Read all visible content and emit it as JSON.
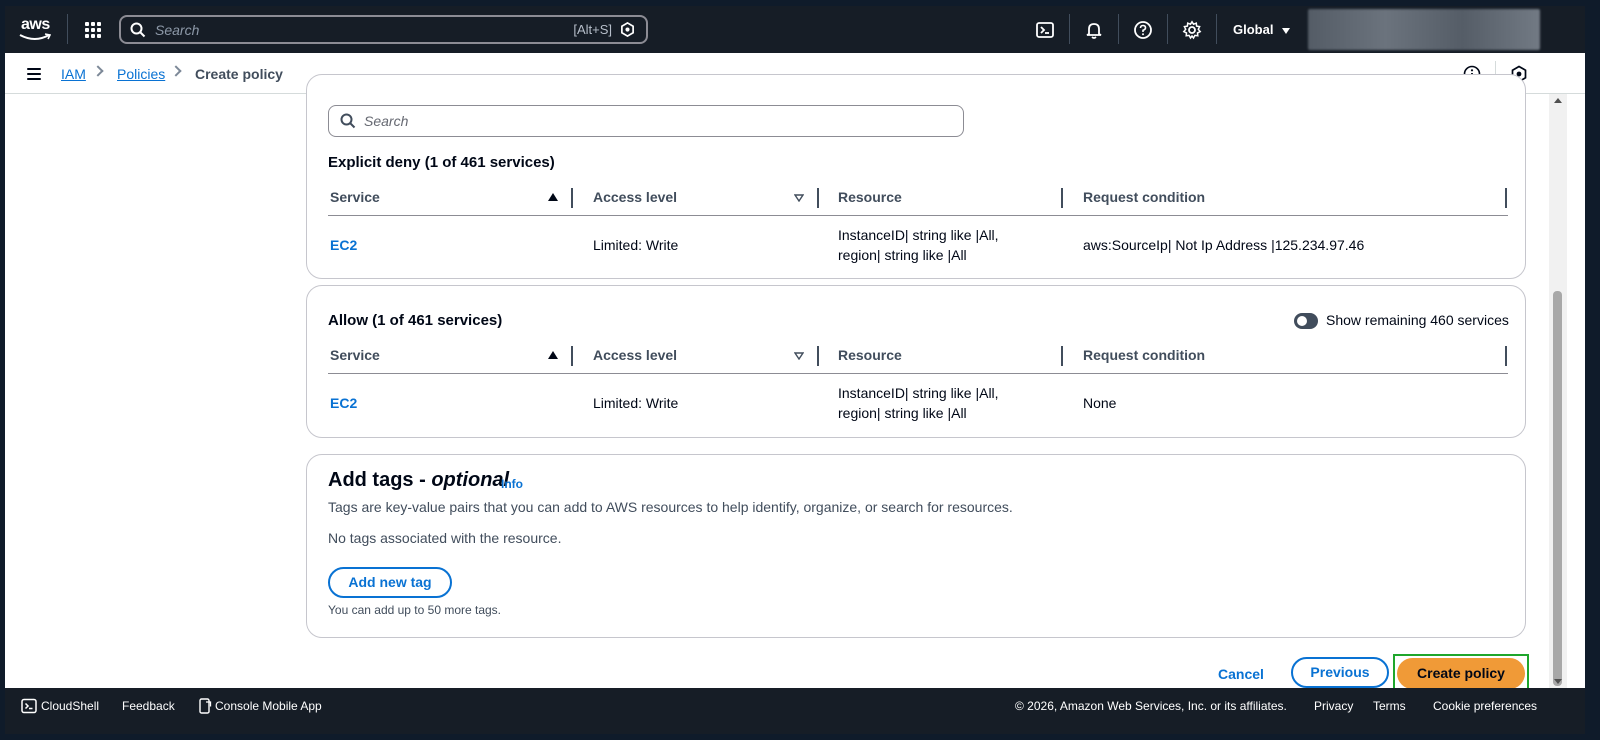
{
  "topnav": {
    "logo_text": "aws",
    "search_placeholder": "Search",
    "search_shortcut": "[Alt+S]",
    "region": "Global",
    "icons": [
      "cloudshell-icon",
      "bell-icon",
      "help-icon",
      "gear-icon"
    ]
  },
  "breadcrumb": {
    "items": [
      "IAM",
      "Policies",
      "Create policy"
    ]
  },
  "explicit_deny": {
    "search_placeholder": "Search",
    "title": "Explicit deny (1 of 461 services)",
    "headers": [
      "Service",
      "Access level",
      "Resource",
      "Request condition"
    ],
    "rows": [
      {
        "service": "EC2",
        "access_level": "Limited: Write",
        "resource_line1": "InstanceID| string like |All,",
        "resource_line2": "region| string like |All",
        "condition": "aws:SourceIp| Not Ip Address |125.234.97.46"
      }
    ]
  },
  "allow": {
    "title": "Allow (1 of 461 services)",
    "toggle_label": "Show remaining 460 services",
    "headers": [
      "Service",
      "Access level",
      "Resource",
      "Request condition"
    ],
    "rows": [
      {
        "service": "EC2",
        "access_level": "Limited: Write",
        "resource_line1": "InstanceID| string like |All,",
        "resource_line2": "region| string like |All",
        "condition": "None"
      }
    ]
  },
  "tags": {
    "title": "Add tags - ",
    "title_optional": "optional",
    "info": "Info",
    "description": "Tags are key-value pairs that you can add to AWS resources to help identify, organize, or search for resources.",
    "empty": "No tags associated with the resource.",
    "add_button": "Add new tag",
    "limit_note": "You can add up to 50 more tags."
  },
  "actions": {
    "cancel": "Cancel",
    "previous": "Previous",
    "create": "Create policy"
  },
  "footer": {
    "cloudshell": "CloudShell",
    "feedback": "Feedback",
    "mobile_app": "Console Mobile App",
    "copyright": "© 2026, Amazon Web Services, Inc. or its affiliates.",
    "privacy": "Privacy",
    "terms": "Terms",
    "cookies": "Cookie preferences"
  },
  "colors": {
    "nav_bg": "#161d26",
    "link": "#0972d3",
    "primary_button": "#f09a37",
    "focus_ring": "#1fa62c"
  }
}
